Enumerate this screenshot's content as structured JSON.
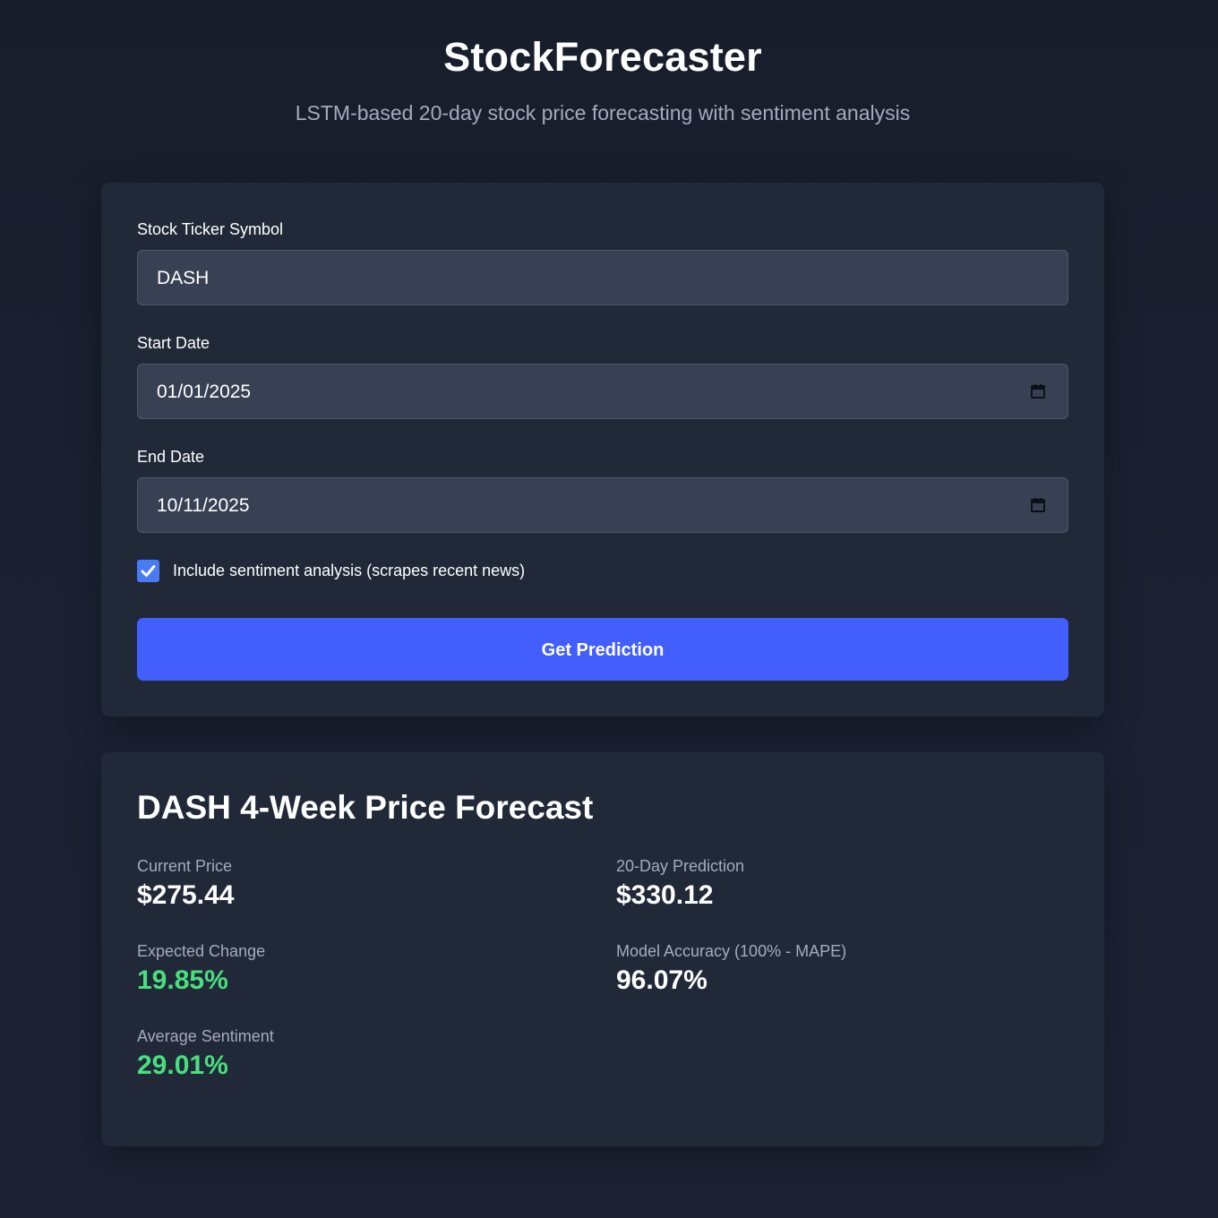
{
  "header": {
    "title": "StockForecaster",
    "subtitle": "LSTM-based 20-day stock price forecasting with sentiment analysis"
  },
  "form": {
    "ticker": {
      "label": "Stock Ticker Symbol",
      "value": "DASH"
    },
    "start_date": {
      "label": "Start Date",
      "value": "01/01/2025"
    },
    "end_date": {
      "label": "End Date",
      "value": "10/11/2025"
    },
    "sentiment_checkbox": {
      "label": "Include sentiment analysis (scrapes recent news)",
      "checked": true
    },
    "submit_label": "Get Prediction"
  },
  "results": {
    "title": "DASH 4-Week Price Forecast",
    "metrics": [
      {
        "label": "Current Price",
        "value": "$275.44"
      },
      {
        "label": "20-Day Prediction",
        "value": "$330.12"
      },
      {
        "label": "Expected Change",
        "value": "19.85%",
        "status": "positive"
      },
      {
        "label": "Model Accuracy (100% - MAPE)",
        "value": "96.07%"
      },
      {
        "label": "Average Sentiment",
        "value": "29.01%",
        "status": "positive"
      }
    ]
  },
  "colors": {
    "accent": "#425ffd",
    "checkbox": "#4a7bf7",
    "positive": "#4ade80",
    "card": "#212939",
    "input": "#384154"
  }
}
